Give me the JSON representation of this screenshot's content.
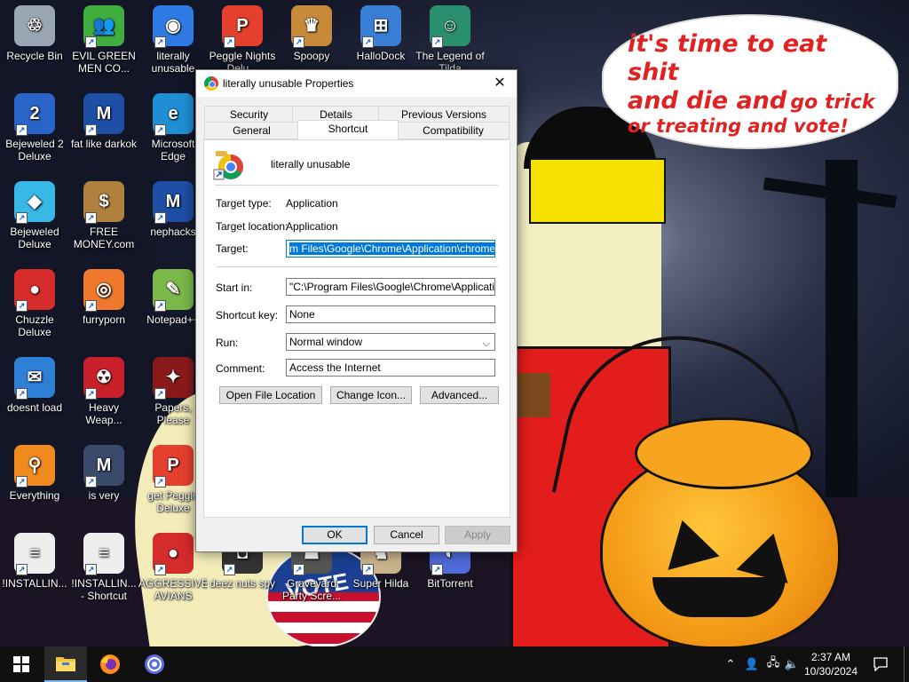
{
  "wallpaper": {
    "speech_bubble": {
      "line1": "it's time to eat shit",
      "line2a": "and die and",
      "line2b": "go trick",
      "line3": "or treating and vote!"
    },
    "badge_text": "VOTE"
  },
  "desktop_icons": [
    {
      "label": "Recycle Bin",
      "icon": "recycle-bin-icon",
      "color": "#9aa6b4",
      "glyph": "♲"
    },
    {
      "label": "EVIL GREEN MEN CO...",
      "icon": "green-men-icon",
      "color": "#3fae3f",
      "glyph": "👥"
    },
    {
      "label": "literally unusable",
      "icon": "chrome-icon",
      "color": "#2f7be5",
      "glyph": "◉"
    },
    {
      "label": "Peggle Nights Delu...",
      "icon": "peggle-icon",
      "color": "#e43f2f",
      "glyph": "P"
    },
    {
      "label": "Spoopy",
      "icon": "spoopy-icon",
      "color": "#c78a3a",
      "glyph": "♛"
    },
    {
      "label": "HalloDock",
      "icon": "windows-icon",
      "color": "#3a7fd6",
      "glyph": "⊞"
    },
    {
      "label": "The Legend of Tilda",
      "icon": "tilda-icon",
      "color": "#2a8f6e",
      "glyph": "☺"
    },
    {
      "label": "Bejeweled 2 Deluxe",
      "icon": "bejeweled2-icon",
      "color": "#2b64c8",
      "glyph": "2"
    },
    {
      "label": "fat like darkok",
      "icon": "mpl-icon",
      "color": "#1d4fa5",
      "glyph": "M"
    },
    {
      "label": "Microsoft Edge",
      "icon": "edge-icon",
      "color": "#1f8fd4",
      "glyph": "e"
    },
    {
      "label": "Bejeweled Deluxe",
      "icon": "diamond-icon",
      "color": "#37b8e6",
      "glyph": "◆"
    },
    {
      "label": "FREE MONEY.com",
      "icon": "money-bag-icon",
      "color": "#b0803e",
      "glyph": "$"
    },
    {
      "label": "nephacks",
      "icon": "mpi-icon",
      "color": "#1d4fa5",
      "glyph": "M"
    },
    {
      "label": "Chuzzle Deluxe",
      "icon": "chuzzle-icon",
      "color": "#d62c2c",
      "glyph": "●"
    },
    {
      "label": "furryporn",
      "icon": "firefox-icon",
      "color": "#f0782d",
      "glyph": "◎"
    },
    {
      "label": "Notepad++",
      "icon": "notepad-icon",
      "color": "#7ab84a",
      "glyph": "✎"
    },
    {
      "label": "doesnt load",
      "icon": "thunderbird-icon",
      "color": "#2e7fd6",
      "glyph": "✉"
    },
    {
      "label": "Heavy Weap...",
      "icon": "radiation-icon",
      "color": "#c8202a",
      "glyph": "☢"
    },
    {
      "label": "Papers, Please",
      "icon": "papers-icon",
      "color": "#8a1a1a",
      "glyph": "✦"
    },
    {
      "label": "Everything",
      "icon": "search-magnifier-icon",
      "color": "#f08a1e",
      "glyph": "⚲"
    },
    {
      "label": "is very",
      "icon": "mp-shield-icon",
      "color": "#3a4a6a",
      "glyph": "M"
    },
    {
      "label": "get Peggle Deluxe",
      "icon": "peggle-deluxe-icon",
      "color": "#e43f2f",
      "glyph": "P"
    },
    {
      "label": "!INSTALLIN...",
      "icon": "document-icon",
      "color": "#eeeeee",
      "glyph": "≡"
    },
    {
      "label": "!INSTALLIN... - Shortcut",
      "icon": "document-shortcut-icon",
      "color": "#eeeeee",
      "glyph": "≡"
    },
    {
      "label": "AGGRESSIVE AVIANS",
      "icon": "angry-bird-icon",
      "color": "#d42b2b",
      "glyph": "●"
    },
    {
      "label": "deez nuts spy",
      "icon": "spy-icon",
      "color": "#333333",
      "glyph": "◘"
    },
    {
      "label": "Graveyard Party Scre...",
      "icon": "graveyard-icon",
      "color": "#555555",
      "glyph": "☗"
    },
    {
      "label": "Super Hilda",
      "icon": "hilda-icon",
      "color": "#c9b38a",
      "glyph": "♞"
    },
    {
      "label": "BitTorrent",
      "icon": "bittorrent-icon",
      "color": "#4f6ad9",
      "glyph": "◐"
    }
  ],
  "dialog": {
    "title": "literally unusable Properties",
    "close_glyph": "✕",
    "tabs_row1": [
      "Security",
      "Details",
      "Previous Versions"
    ],
    "tabs_row2": [
      "General",
      "Shortcut",
      "Compatibility"
    ],
    "active_tab": "Shortcut",
    "shortcut_name": "literally unusable",
    "target_type_label": "Target type:",
    "target_type_value": "Application",
    "target_location_label": "Target location:",
    "target_location_value": "Application",
    "target_label": "Target:",
    "target_value": "m Files\\Google\\Chrome\\Application\\chrome.exe\"",
    "start_in_label": "Start in:",
    "start_in_value": "\"C:\\Program Files\\Google\\Chrome\\Application\"",
    "shortcut_key_label": "Shortcut key:",
    "shortcut_key_value": "None",
    "run_label": "Run:",
    "run_value": "Normal window",
    "comment_label": "Comment:",
    "comment_value": "Access the Internet",
    "btn_open_location": "Open File Location",
    "btn_change_icon": "Change Icon...",
    "btn_advanced": "Advanced...",
    "btn_ok": "OK",
    "btn_cancel": "Cancel",
    "btn_apply": "Apply"
  },
  "taskbar": {
    "time": "2:37 AM",
    "date": "10/30/2024"
  },
  "colors": {
    "accent": "#0078d7",
    "taskbar": "#101010",
    "bubble_text": "#e02222"
  }
}
